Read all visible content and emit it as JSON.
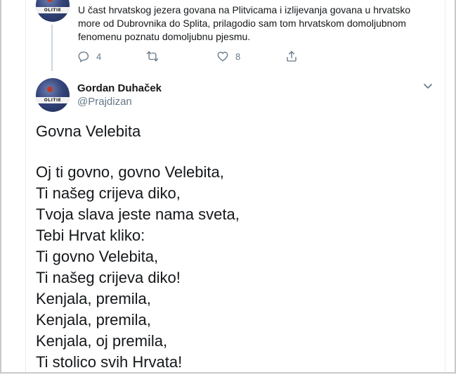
{
  "previous_tweet": {
    "avatar_text": "OLITIE",
    "text_lines": [
      "U čast hrvatskog jezera govana na Plitvicama i izlijevanja govana u hrvatsko",
      "more od Dubrovnika do Splita, prilagodio sam tom hrvatskom domoljubnom",
      "fenomenu poznatu domoljubnu pjesmu."
    ],
    "actions": {
      "reply_count": "4",
      "retweet_count": "",
      "like_count": "8"
    }
  },
  "tweet": {
    "author_name": "Gordan Duhaček",
    "handle": "@Prajdizan",
    "avatar_text": "OLITIE",
    "lines": [
      "Govna Velebita",
      "",
      "Oj ti govno, govno Velebita,",
      "Ti našeg crijeva diko,",
      "Tvoja slava jeste nama sveta,",
      "Tebi Hrvat kliko:",
      "Ti govno Velebita,",
      "Ti našeg crijeva diko!",
      "Kenjala, premila,",
      "Kenjala, premila,",
      "Kenjala, oj premila,",
      "Ti stolico svih Hrvata!"
    ]
  },
  "colors": {
    "text": "#14171a",
    "secondary": "#657786",
    "border": "#e6ecf0",
    "frame": "#c9c9c9"
  }
}
